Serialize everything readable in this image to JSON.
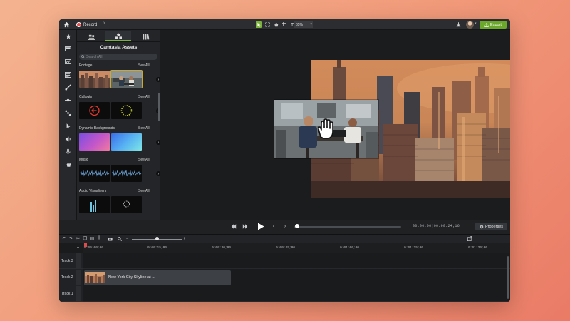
{
  "topbar": {
    "record_label": "Record",
    "zoom_value": "85%",
    "export_label": "Export"
  },
  "assets": {
    "title": "Camtasia Assets",
    "search_placeholder": "Search All",
    "see_all": "See All",
    "categories": [
      {
        "label": "Footage"
      },
      {
        "label": "Callouts"
      },
      {
        "label": "Dynamic Backgrounds"
      },
      {
        "label": "Music"
      },
      {
        "label": "Audio Visualizers"
      }
    ]
  },
  "playback": {
    "timecode": "00:00:00|00:00:24;16",
    "properties_label": "Properties"
  },
  "timeline": {
    "ruler": [
      "0:00:00;00",
      "0:00:15;00",
      "0:00:30;00",
      "0:00:45;00",
      "0:01:00;00",
      "0:01:15;00",
      "0:01:30;00"
    ],
    "tracks": [
      {
        "name": "Track 3"
      },
      {
        "name": "Track 2"
      },
      {
        "name": "Track 1"
      }
    ],
    "clip_name": "New York City Skyline at ..."
  },
  "colors": {
    "accent_green": "#6aa72a",
    "record_red": "#e24b4b",
    "selection_gold": "#c7a93a"
  },
  "icons": {
    "rail": [
      "star-icon",
      "media-icon",
      "library-icon",
      "annotations-icon",
      "transitions-icon",
      "behaviors-icon",
      "animations-icon",
      "cursor-effects-icon",
      "audio-effects-icon",
      "voice-narration-icon",
      "interactivity-icon"
    ]
  }
}
